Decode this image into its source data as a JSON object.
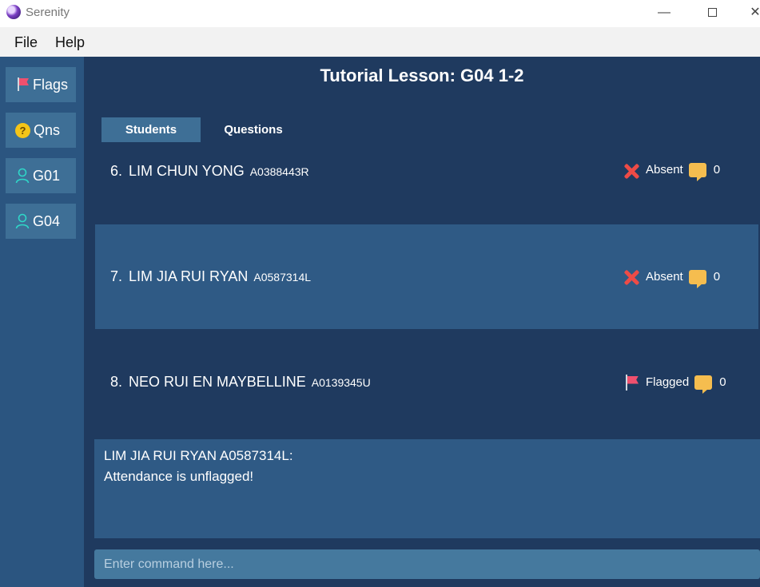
{
  "window": {
    "title": "Serenity",
    "minimize": "—",
    "close": "✕"
  },
  "menu": {
    "file": "File",
    "help": "Help"
  },
  "sidebar": {
    "items": [
      {
        "label": "Flags",
        "icon": "flag-icon"
      },
      {
        "label": "Qns",
        "icon": "question-icon"
      },
      {
        "label": "G01",
        "icon": "user-icon"
      },
      {
        "label": "G04",
        "icon": "user-icon"
      }
    ]
  },
  "main": {
    "title": "Tutorial Lesson: G04 1-2",
    "tabs": [
      {
        "label": "Students",
        "selected": true
      },
      {
        "label": "Questions",
        "selected": false
      }
    ],
    "students": [
      {
        "index": "6.",
        "name": "LIM CHUN YONG",
        "matric": "A0388443R",
        "status": "Absent",
        "status_icon": "cross-icon",
        "count": "0"
      },
      {
        "index": "7.",
        "name": "LIM JIA RUI RYAN",
        "matric": "A0587314L",
        "status": "Absent",
        "status_icon": "cross-icon",
        "count": "0"
      },
      {
        "index": "8.",
        "name": "NEO RUI EN MAYBELLINE",
        "matric": "A0139345U",
        "status": "Flagged",
        "status_icon": "flag-icon",
        "count": "0"
      }
    ]
  },
  "result": {
    "line1": "LIM JIA RUI RYAN A0587314L:",
    "line2": "Attendance is unflagged!"
  },
  "command": {
    "placeholder": "Enter command here..."
  },
  "colors": {
    "background": "#1f3a5f",
    "sidebar": "#2b5580",
    "button": "#3e6f96",
    "row_alt": "#2f5a85",
    "absent_icon": "#ee4b46",
    "flag_icon": "#f0506e",
    "bubble_icon": "#f5bd4f"
  }
}
